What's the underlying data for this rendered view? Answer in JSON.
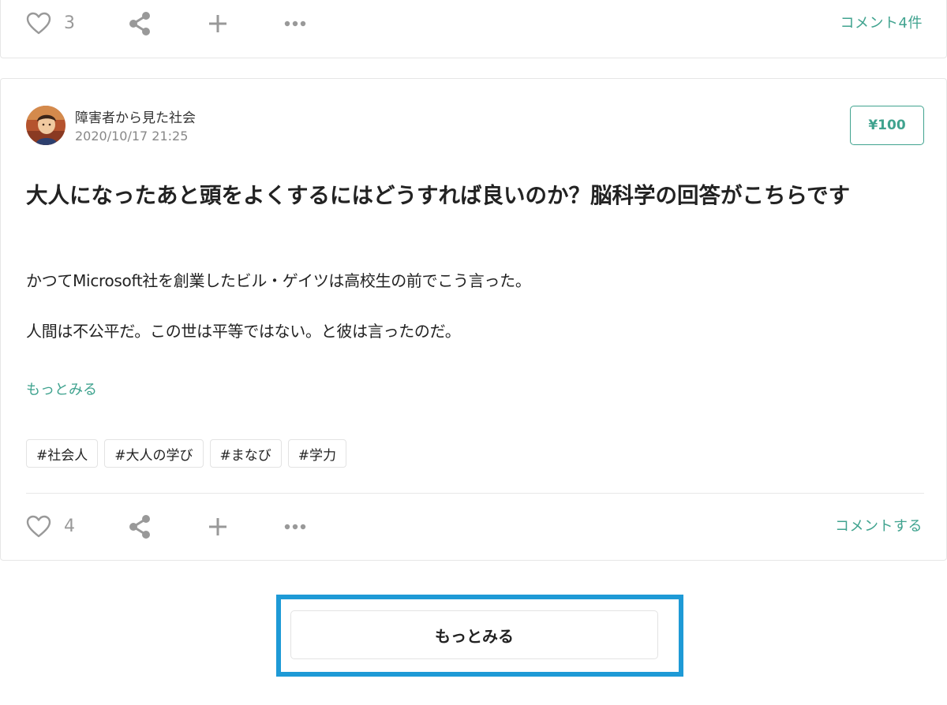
{
  "previous_post": {
    "like_count": "3",
    "comment_link": "コメント4件"
  },
  "post": {
    "author_name": "障害者から見た社会",
    "date": "2020/10/17 21:25",
    "price_label": "¥100",
    "title": "大人になったあと頭をよくするにはどうすれば良いのか？脳科学の回答がこちらです",
    "excerpt": [
      "かつてMicrosoft社を創業したビル・ゲイツは高校生の前でこう言った。",
      "人間は不公平だ。この世は平等ではない。と彼は言ったのだ。"
    ],
    "read_more_label": "もっとみる",
    "tags": [
      "#社会人",
      "#大人の学び",
      "#まなび",
      "#学力"
    ],
    "like_count": "4",
    "comment_link": "コメントする"
  },
  "load_more": {
    "label": "もっとみる"
  },
  "colors": {
    "accent": "#40a38f",
    "icon": "#999999",
    "focus_frame": "#1e9ad6"
  },
  "icons": [
    "heart-icon",
    "share-icon",
    "plus-icon",
    "ellipsis-icon"
  ]
}
